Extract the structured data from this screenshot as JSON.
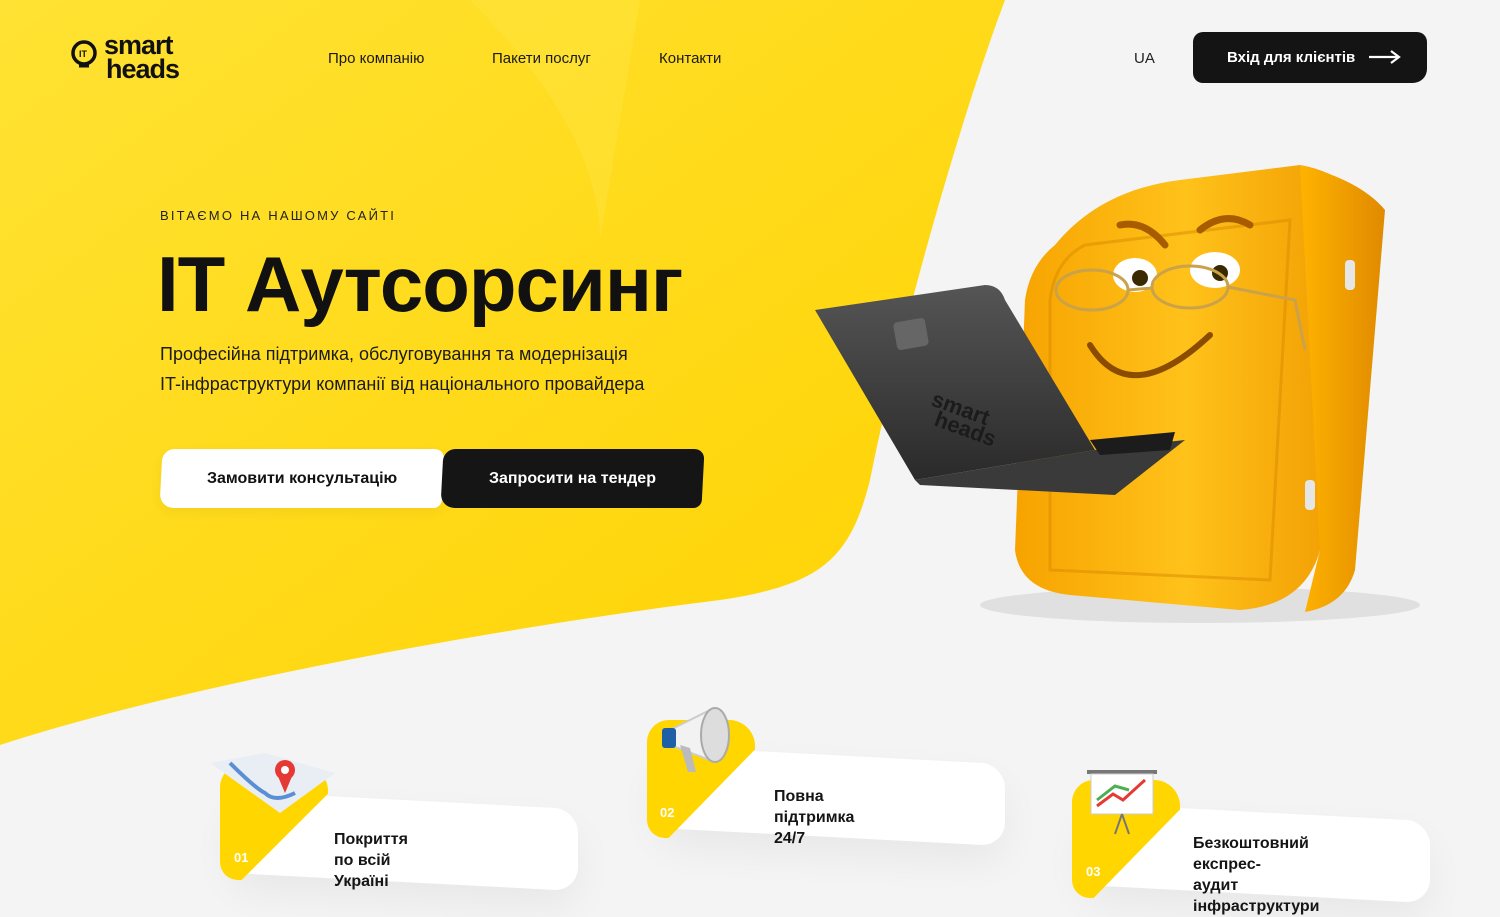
{
  "brand": {
    "line1": "smart",
    "line2": "heads",
    "mark_text": "IT"
  },
  "nav": {
    "about": "Про компанію",
    "packages": "Пакети послуг",
    "contacts": "Контакти",
    "lang": "UA",
    "client_login": "Вхід для клієнтів"
  },
  "hero": {
    "kicker": "ВІТАЄМО НА НАШОМУ САЙТІ",
    "title": "IT Аутсорсинг",
    "subtitle_line1": "Професійна підтримка, обслуговування та модернізація",
    "subtitle_line2": "IT-інфраструктури компанії від національного провайдера",
    "cta_primary": "Замовити консультацію",
    "cta_secondary": "Запросити на тендер"
  },
  "laptop_logo": {
    "line1": "smart",
    "line2": "heads"
  },
  "features": [
    {
      "num": "01",
      "label": "Покриття по всій Україні",
      "icon": "map-pin-icon"
    },
    {
      "num": "02",
      "label": "Повна підтримка 24/7",
      "icon": "megaphone-icon"
    },
    {
      "num": "03",
      "label_line1": "Безкоштовний експрес-",
      "label_line2": "аудит інфраструктури",
      "icon": "growth-chart-icon"
    }
  ],
  "colors": {
    "accent": "#ffd600",
    "dark": "#141414",
    "background": "#f4f4f4"
  }
}
